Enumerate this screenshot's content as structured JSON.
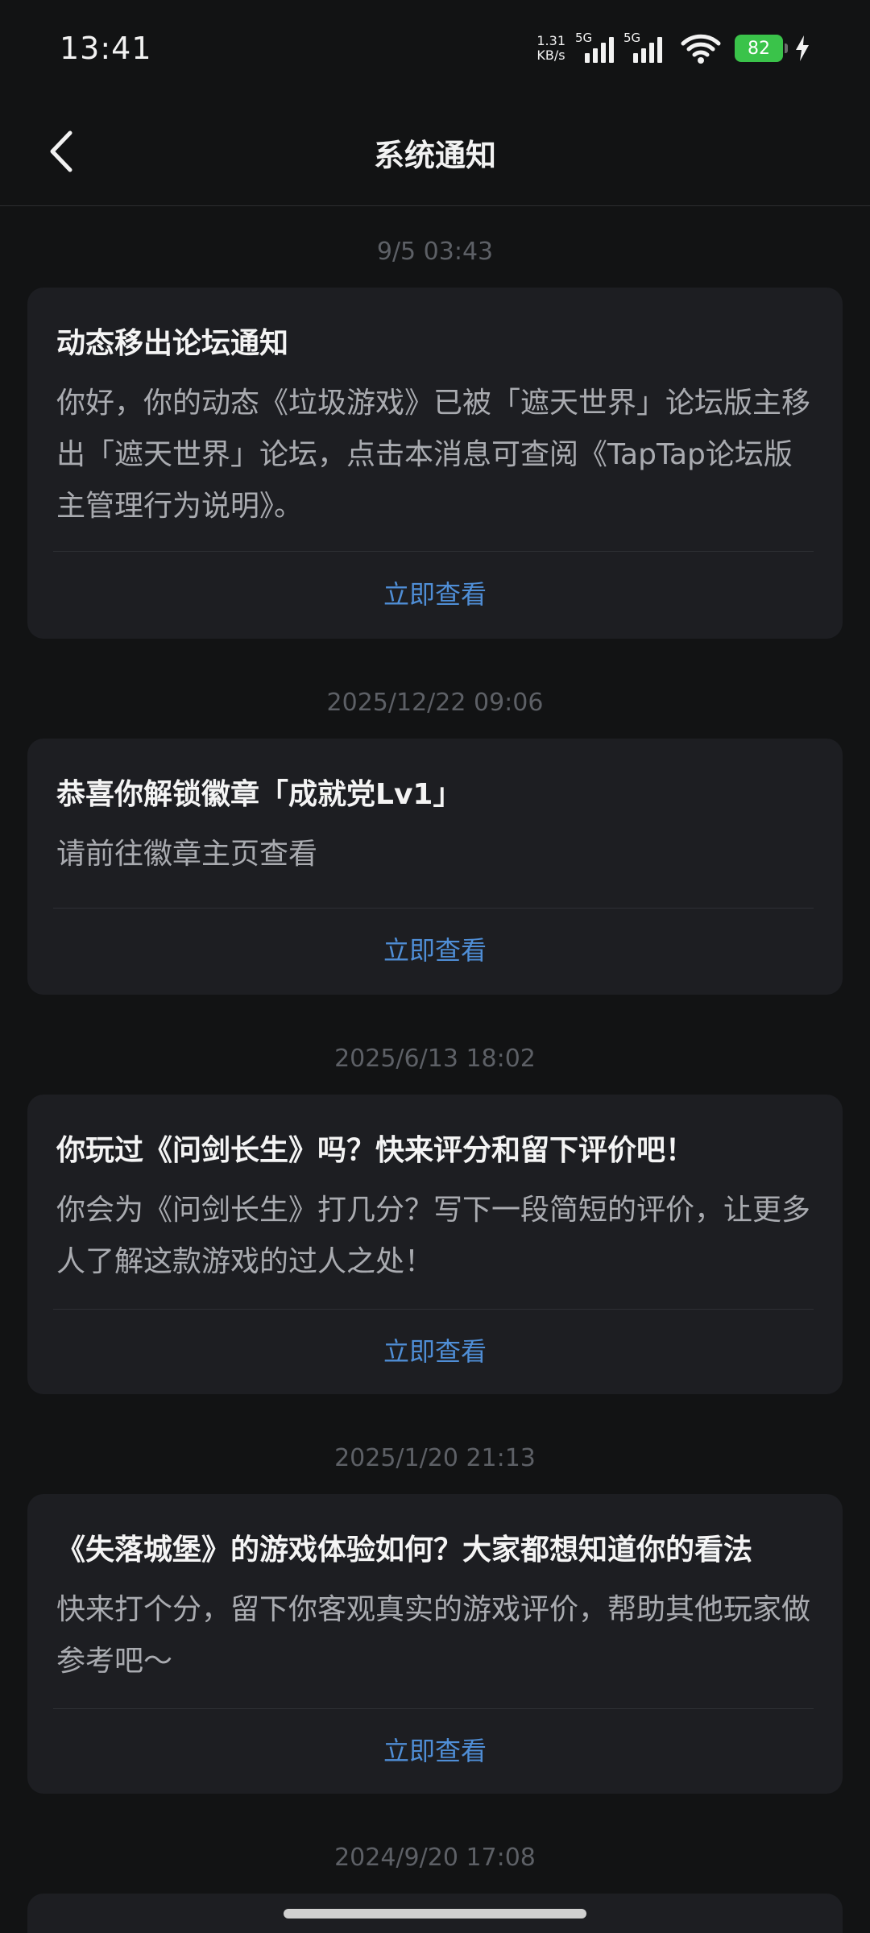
{
  "status_bar": {
    "time": "13:41",
    "net_speed_value": "1.31",
    "net_speed_unit": "KB/s",
    "sim1_tag": "5G",
    "sim2_tag": "5G",
    "battery_level": "82",
    "battery_color": "#3ac34a"
  },
  "header": {
    "title": "系统通知"
  },
  "notifications": [
    {
      "timestamp": "9/5  03:43",
      "title": "动态移出论坛通知",
      "body": "你好，你的动态《垃圾游戏》已被「遮天世界」论坛版主移出「遮天世界」论坛，点击本消息可查阅《TapTap论坛版主管理行为说明》。",
      "action": "立即查看"
    },
    {
      "timestamp": "2025/12/22  09:06",
      "title": "恭喜你解锁徽章「成就党Lv1」",
      "body": "请前往徽章主页查看",
      "action": "立即查看"
    },
    {
      "timestamp": "2025/6/13  18:02",
      "title": "你玩过《问剑长生》吗？快来评分和留下评价吧！",
      "body": "你会为《问剑长生》打几分？写下一段简短的评价，让更多人了解这款游戏的过人之处！",
      "action": "立即查看"
    },
    {
      "timestamp": "2025/1/20  21:13",
      "title": "《失落城堡》的游戏体验如何？大家都想知道你的看法",
      "body": "快来打个分，留下你客观真实的游戏评价，帮助其他玩家做参考吧～",
      "action": "立即查看"
    },
    {
      "timestamp": "2024/9/20  17:08"
    }
  ],
  "colors": {
    "background": "#121314",
    "card": "#1d1e22",
    "accent": "#4f8ed6",
    "timestamp": "#5d6066"
  }
}
